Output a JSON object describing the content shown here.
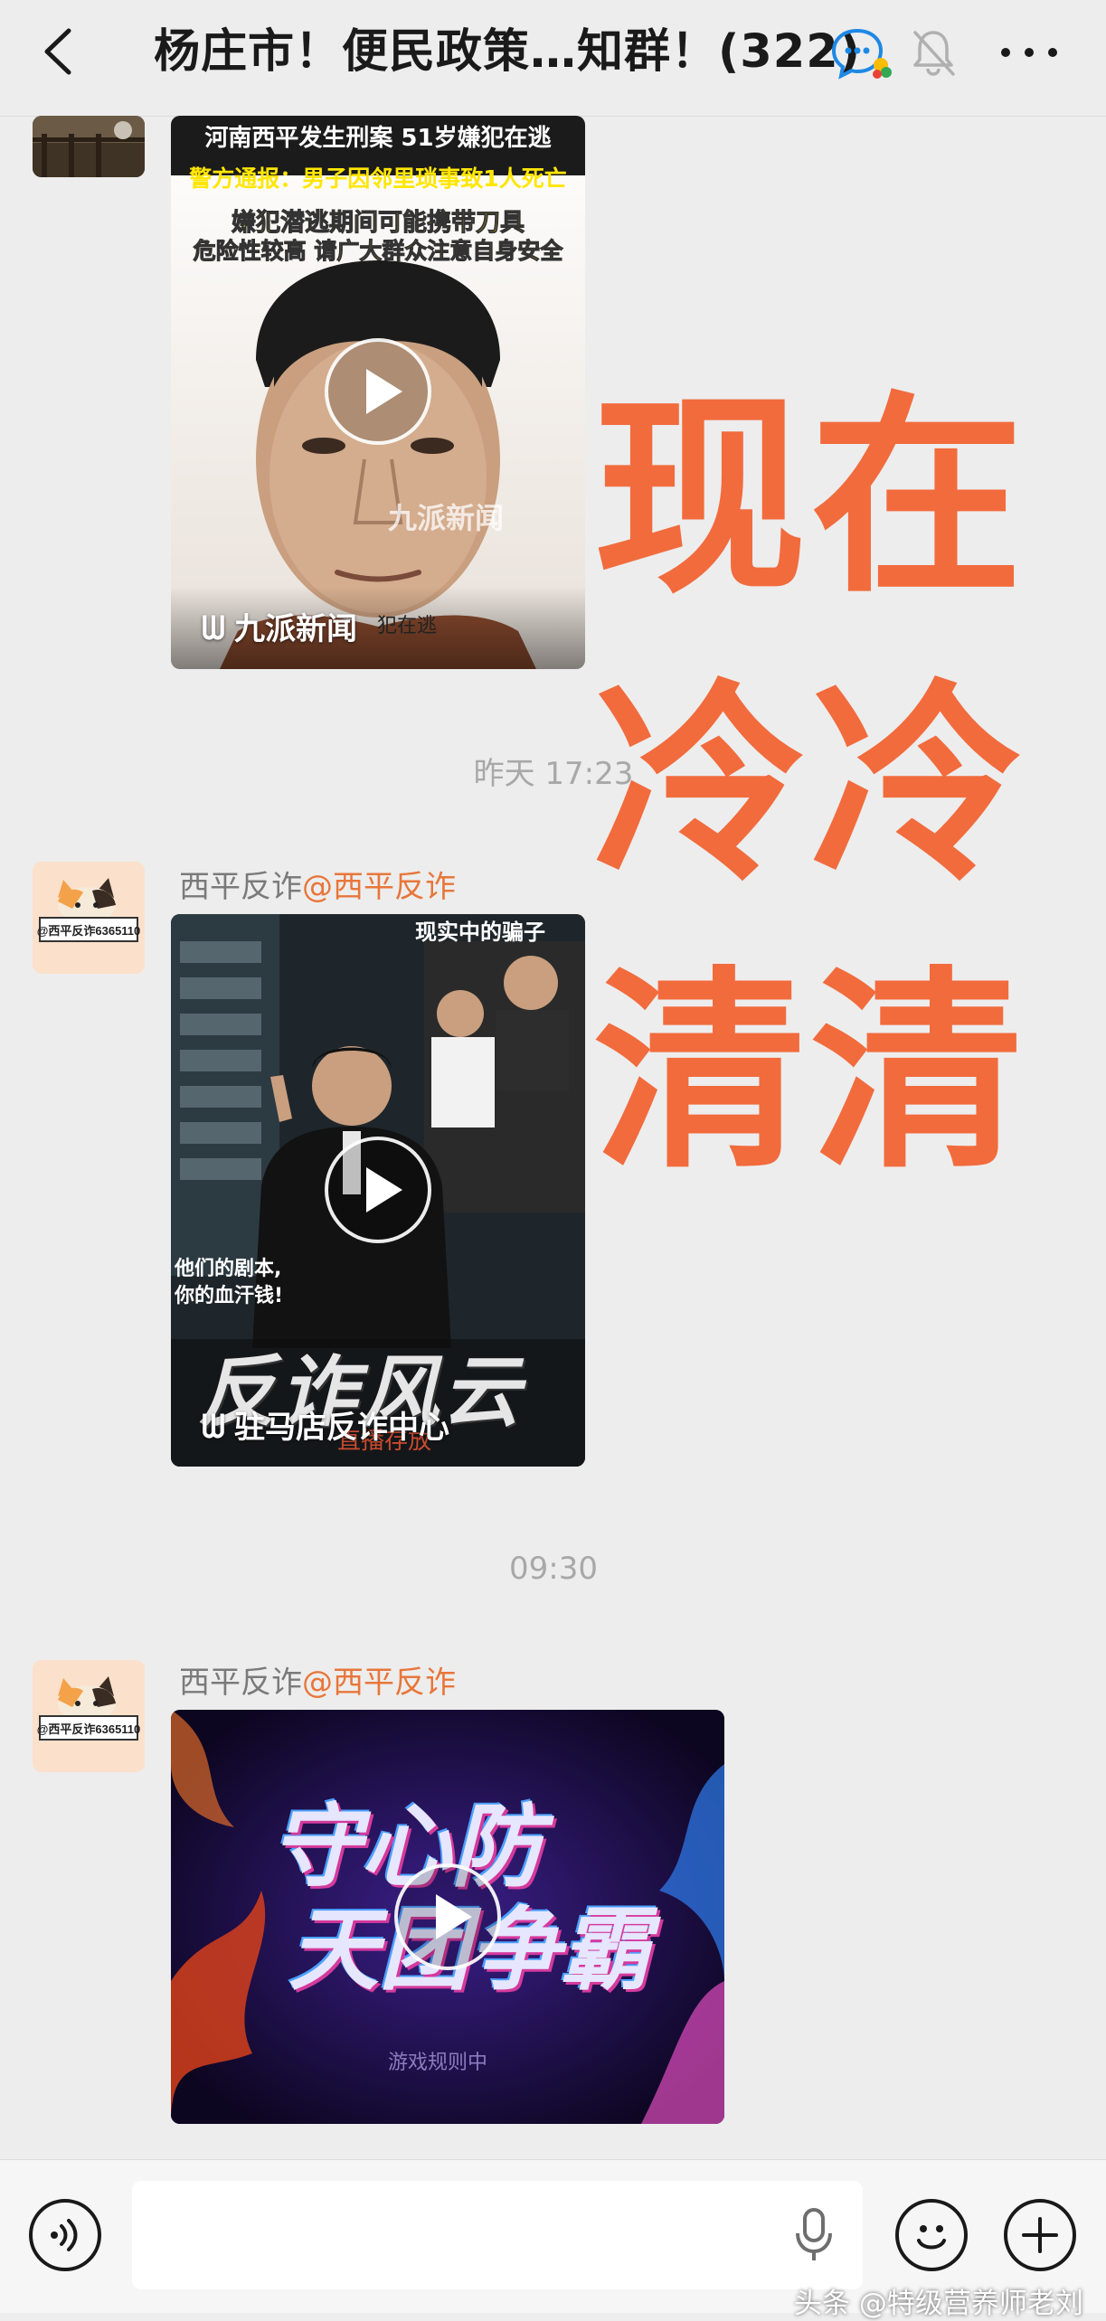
{
  "header": {
    "title": "杨庄市！便民政策…知群！(322)",
    "back_icon": "chevron-left-icon",
    "chat_icon": "group-chat-icon",
    "mute_icon": "bell-muted-icon",
    "more_icon": "more-dots-icon"
  },
  "messages": [
    {
      "video_title_line1": "河南西平发生刑案 51岁嫌犯在逃",
      "video_title_line2": "警方通报：男子因邻里琐事致1人死亡",
      "video_title_line3": "嫌犯潜逃期间可能携带刀具",
      "video_title_line4": "危险性较高 请广大群众注意自身安全",
      "source": "九派新闻",
      "watermark": "九派新闻",
      "caption_fragment": "犯在逃"
    },
    {
      "timestamp": "昨天 17:23",
      "sender_name": "西平反诈",
      "sender_at": "@西平反诈",
      "avatar_text": "@西平反诈6365110",
      "video_tag": "现实中的骗子",
      "video_sub1": "他们的剧本,",
      "video_sub2": "你的血汗钱!",
      "video_big": "反诈风云",
      "video_small": "直播存放",
      "source": "驻马店反诈中心"
    },
    {
      "timestamp": "09:30",
      "sender_name": "西平反诈",
      "sender_at": "@西平反诈",
      "avatar_text": "@西平反诈6365110",
      "video_line1": "守心防",
      "video_line2": "天团争霸",
      "video_small": "游戏规则中"
    }
  ],
  "overlay": {
    "line1": "现在",
    "line2": "冷冷",
    "line3": "清清",
    "color": "#f26b3d"
  },
  "bottom_bar": {
    "voice_icon": "voice-icon",
    "mic_icon": "mic-icon",
    "emoji_icon": "emoji-icon",
    "plus_icon": "plus-icon",
    "watermark": "头条 @特级营养师老刘"
  }
}
